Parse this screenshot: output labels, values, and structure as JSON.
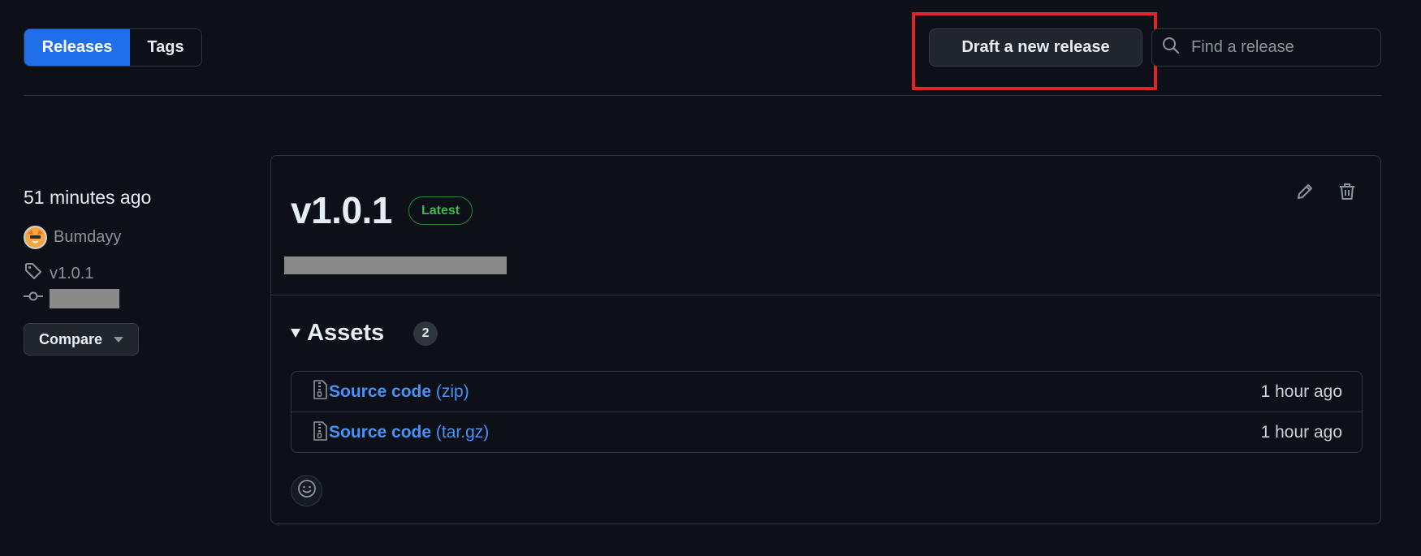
{
  "header": {
    "tabs": [
      {
        "label": "Releases",
        "active": true
      },
      {
        "label": "Tags",
        "active": false
      }
    ],
    "draft_button_label": "Draft a new release",
    "search": {
      "placeholder": "Find a release",
      "value": ""
    }
  },
  "meta": {
    "time": "51 minutes ago",
    "author": "Bumdayy",
    "tag": "v1.0.1",
    "compare_label": "Compare"
  },
  "release": {
    "version": "v1.0.1",
    "badge": "Latest",
    "assets": {
      "title": "Assets",
      "count": "2",
      "items": [
        {
          "name": "Source code",
          "ext": "(zip)",
          "time": "1 hour ago"
        },
        {
          "name": "Source code",
          "ext": "(tar.gz)",
          "time": "1 hour ago"
        }
      ]
    }
  },
  "colors": {
    "background": "#0d1117",
    "accent": "#1f6feb",
    "link": "#4493f8",
    "latest_badge": "#3fb950",
    "highlight": "#e0252a"
  }
}
